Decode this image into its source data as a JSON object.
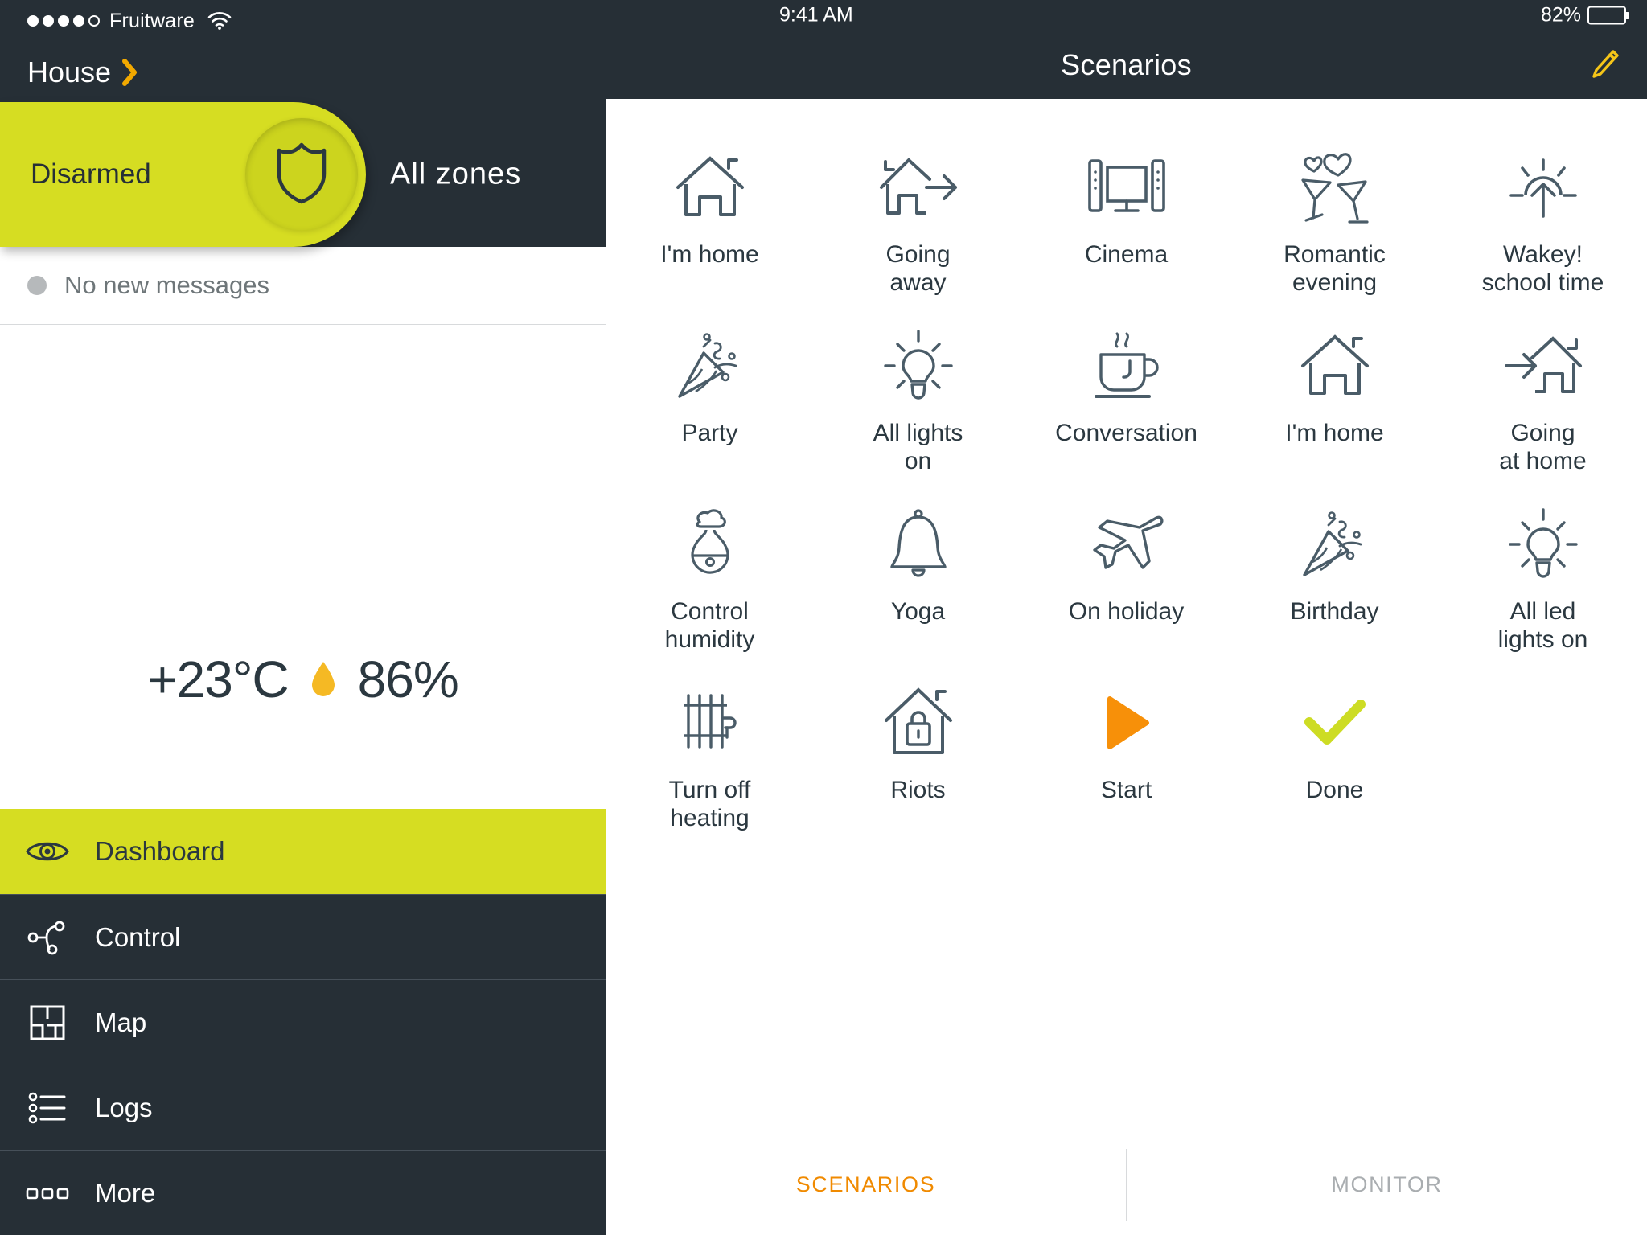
{
  "left": {
    "status_bar": {
      "carrier": "Fruitware",
      "signal_dots_filled": 4,
      "signal_dots_total": 5,
      "wifi_icon": "wifi-icon"
    },
    "house": {
      "label": "House",
      "chevron_icon": "chevron-right-icon",
      "chevron_color": "#f2a900"
    },
    "arm": {
      "state": "Disarmed",
      "zones": "All zones",
      "shield_icon": "shield-icon",
      "pill_color": "#d6dd22"
    },
    "messages": {
      "text": "No new messages",
      "dot_color": "#b6b9bb"
    },
    "weather": {
      "temperature": "+23°C",
      "humidity": "86%",
      "drop_icon": "water-drop-icon",
      "drop_color": "#f5b924"
    },
    "nav": {
      "items": [
        {
          "label": "Dashboard",
          "icon": "eye-icon",
          "active": true
        },
        {
          "label": "Control",
          "icon": "control-nodes-icon",
          "active": false
        },
        {
          "label": "Map",
          "icon": "floorplan-map-icon",
          "active": false
        },
        {
          "label": "Logs",
          "icon": "list-logs-icon",
          "active": false
        },
        {
          "label": "More",
          "icon": "more-dots-icon",
          "active": false
        }
      ]
    }
  },
  "right": {
    "status_bar": {
      "time": "9:41 AM",
      "battery_percent": "82%",
      "battery_level": 82
    },
    "header": {
      "title": "Scenarios",
      "edit_icon": "pencil-edit-icon",
      "edit_color": "#f5c518"
    },
    "scenarios": [
      {
        "label": "I'm home",
        "icon": "house-icon"
      },
      {
        "label": "Going\naway",
        "icon": "house-arrow-out-icon"
      },
      {
        "label": "Cinema",
        "icon": "tv-speakers-icon"
      },
      {
        "label": "Romantic\nevening",
        "icon": "cocktail-hearts-icon"
      },
      {
        "label": "Wakey!\nschool time",
        "icon": "sunrise-icon"
      },
      {
        "label": "Party",
        "icon": "party-popper-icon"
      },
      {
        "label": "All lights\non",
        "icon": "lightbulb-icon"
      },
      {
        "label": "Conversation",
        "icon": "coffee-cup-icon"
      },
      {
        "label": "I'm home",
        "icon": "house-icon"
      },
      {
        "label": "Going\nat home",
        "icon": "house-arrow-in-icon"
      },
      {
        "label": "Control\nhumidity",
        "icon": "humidity-icon"
      },
      {
        "label": "Yoga",
        "icon": "bell-icon"
      },
      {
        "label": "On holiday",
        "icon": "airplane-icon"
      },
      {
        "label": "Birthday",
        "icon": "party-popper-icon"
      },
      {
        "label": "All led\nlights on",
        "icon": "lightbulb-icon"
      },
      {
        "label": "Turn off\nheating",
        "icon": "radiator-icon"
      },
      {
        "label": "Riots",
        "icon": "house-lock-icon"
      },
      {
        "label": "Start",
        "icon": "play-triangle-icon"
      },
      {
        "label": "Done",
        "icon": "check-mark-icon"
      }
    ],
    "tabs": [
      {
        "label": "SCENARIOS",
        "active": true
      },
      {
        "label": "MONITOR",
        "active": false
      }
    ]
  },
  "colors": {
    "accent_yellow": "#d6dd22",
    "dark": "#262f36",
    "orange": "#f08a00",
    "icon_stroke": "#4a5c68"
  }
}
